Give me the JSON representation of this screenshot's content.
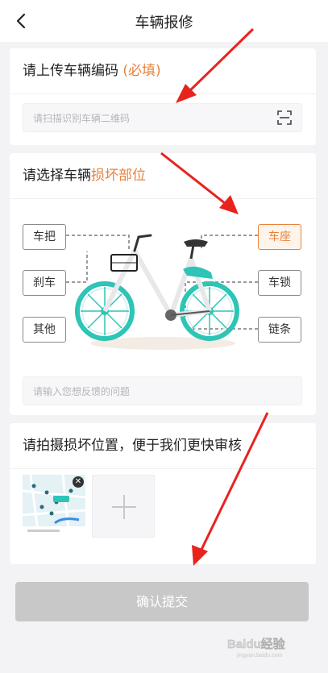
{
  "header": {
    "title": "车辆报修",
    "back_icon": "chevron-left-icon"
  },
  "code_section": {
    "title": "请上传车辆编码",
    "required": "(必填)",
    "placeholder": "请扫描识别车辆二维码",
    "scan_icon": "scan-icon"
  },
  "damage_section": {
    "title_prefix": "请选择车辆",
    "title_highlight": "损坏部位",
    "parts": [
      {
        "label": "车把",
        "selected": false
      },
      {
        "label": "刹车",
        "selected": false
      },
      {
        "label": "其他",
        "selected": false
      },
      {
        "label": "车座",
        "selected": true
      },
      {
        "label": "车锁",
        "selected": false
      },
      {
        "label": "链条",
        "selected": false
      }
    ],
    "feedback_placeholder": "请输入您想反馈的问题"
  },
  "photo_section": {
    "title": "请拍摄损坏位置，便于我们更快审核",
    "close_icon": "close-icon",
    "add_icon": "plus-icon"
  },
  "submit_label": "确认提交",
  "colors": {
    "accent": "#e8823a",
    "bike_teal": "#2ec4b6",
    "button_disabled": "#c8c8c8",
    "arrow_red": "#e8231e"
  },
  "watermark": {
    "text": "Baidu经验",
    "subtitle": "jingyan.baidu.com"
  }
}
